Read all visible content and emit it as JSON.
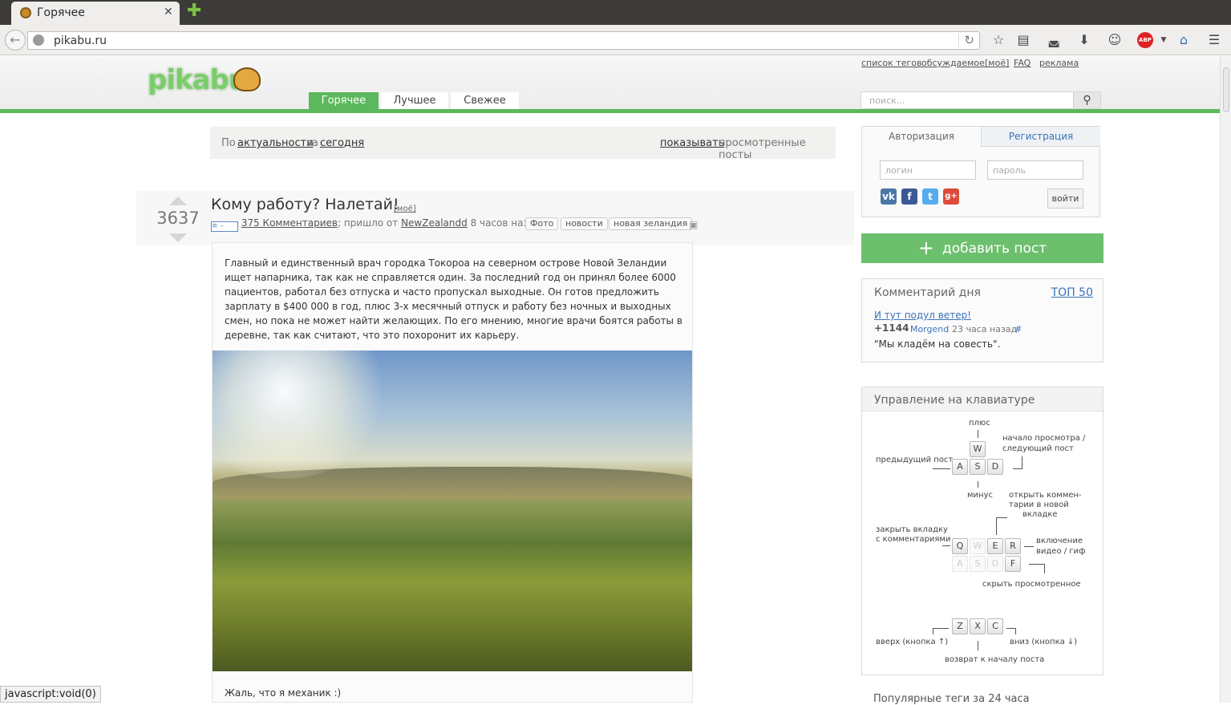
{
  "browser": {
    "tab_title": "Горячее",
    "url": "pikabu.ru",
    "status_text": "javascript:void(0)",
    "icons": [
      "back-icon",
      "globe-icon",
      "reload-icon",
      "star-icon",
      "reading-list-icon",
      "pocket-icon",
      "download-icon",
      "smiley-icon",
      "adblock-icon",
      "dropdown-icon",
      "sync-icon",
      "menu-icon"
    ]
  },
  "header": {
    "logo": "pikabu",
    "top_links": [
      "список тегов",
      "обсуждаемое",
      "[моё]",
      "FAQ",
      "реклама"
    ],
    "tabs": [
      "Горячее",
      "Лучшее",
      "Свежее"
    ],
    "search_placeholder": "поиск..."
  },
  "filter": {
    "prefix": "По",
    "sort": "актуальности",
    "middle": "за",
    "period": "сегодня",
    "show_link": "показывать",
    "show_rest": "просмотренные посты"
  },
  "post": {
    "score": "3637",
    "title": "Кому работу? Налетай!",
    "mine": "[моё]",
    "comments": "375 Комментариев",
    "from_text": "; пришло от",
    "author": "NewZealandd",
    "time": "8 часов назад",
    "tags": [
      "Фото",
      "новости",
      "новая зеландия"
    ],
    "body": "Главный и единственный врач городка Токороа на северном острове Новой Зеландии ищет напарника, так как не справляется один. За последний год он принял более 6000 пациентов, работал без отпуска и часто пропускал выходные. Он готов предложить зарплату в $400 000 в год, плюс 3-х месячный отпуск и работу без ночных и выходных смен, но пока не может найти желающих. По его мнению, многие врачи боятся работы в деревне, так как считают, что это похоронит их карьеру.",
    "after_text": "Жаль, что я механик :)"
  },
  "auth": {
    "tab_login": "Авторизация",
    "tab_register": "Регистрация",
    "login_placeholder": "логин",
    "password_placeholder": "пароль",
    "social": [
      "vk",
      "f",
      "t",
      "g+"
    ],
    "submit": "войти"
  },
  "add_post": "добавить пост",
  "comment_of_day": {
    "title": "Комментарий дня",
    "top_link": "ТОП 50",
    "post_link": "И тут подул ветер!",
    "score": "+1144",
    "user": "Morgend",
    "time": "23 часа назад",
    "hash": "#",
    "text": "\"Мы кладём на совесть\"."
  },
  "keyboard": {
    "title": "Управление на клавиатуре",
    "labels": {
      "plus": "плюс",
      "next_a": "начало просмотра /",
      "next_b": "следующий пост",
      "prev": "предыдущий пост",
      "minus": "минус",
      "open_a": "открыть коммен-",
      "open_b": "тарии в новой",
      "open_c": "вкладке",
      "close_a": "закрыть вкладку",
      "close_b": "с комментариями",
      "video_a": "включение",
      "video_b": "видео / гиф",
      "hide": "скрыть просмотренное",
      "up": "вверх (кнопка ↑)",
      "down": "вниз (кнопка ↓)",
      "back": "возврат к началу поста"
    },
    "keys1": [
      "W",
      "A",
      "S",
      "D"
    ],
    "keys2": [
      "Q",
      "W",
      "E",
      "R",
      "A",
      "S",
      "D",
      "F"
    ],
    "keys3": [
      "Z",
      "X",
      "C"
    ]
  },
  "popular_tags": "Популярные теги за 24 часа"
}
